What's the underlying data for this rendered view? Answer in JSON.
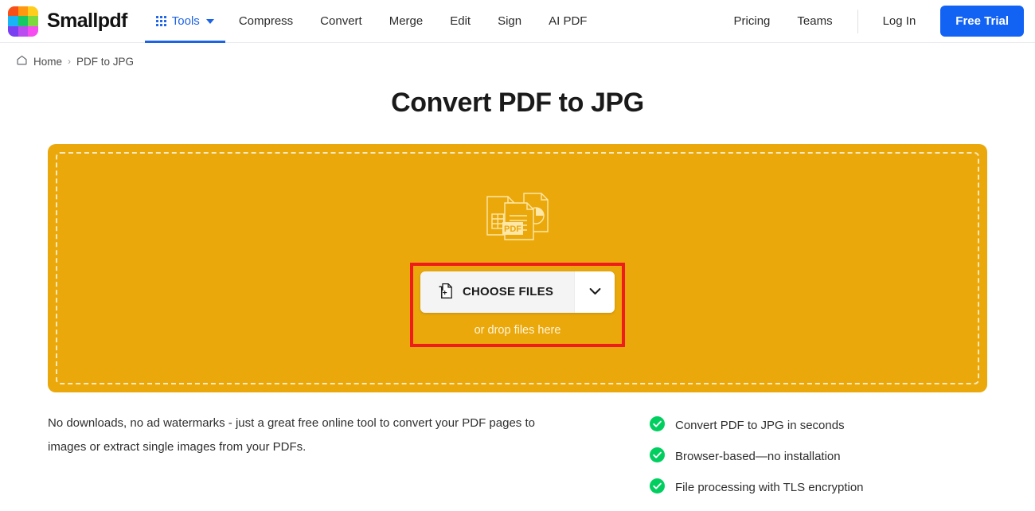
{
  "brand": {
    "name": "Smallpdf",
    "logo_colors": [
      "#f94f18",
      "#ff9811",
      "#ffcd1b",
      "#19b4f5",
      "#17c964",
      "#7ed93f",
      "#7b3ff2",
      "#bb4df0",
      "#f54df0"
    ]
  },
  "header": {
    "tools": {
      "label": "Tools",
      "icon": "grid-dots-icon",
      "caret": "chevron-down-icon",
      "active": true
    },
    "nav_items": [
      {
        "label": "Compress"
      },
      {
        "label": "Convert"
      },
      {
        "label": "Merge"
      },
      {
        "label": "Edit"
      },
      {
        "label": "Sign"
      },
      {
        "label": "AI PDF"
      }
    ],
    "right_items": [
      {
        "label": "Pricing"
      },
      {
        "label": "Teams"
      }
    ],
    "login_label": "Log In",
    "trial_label": "Free Trial",
    "accent_blue": "#1263f4"
  },
  "breadcrumb": {
    "home_icon": "home-icon",
    "home_label": "Home",
    "separator": "›",
    "current_label": "PDF to JPG"
  },
  "main": {
    "title": "Convert PDF to JPG"
  },
  "dropzone": {
    "background_color": "#eaa80b",
    "illustration": "pdf-documents-icon",
    "illustration_badge": "PDF",
    "choose_files_label": "CHOOSE FILES",
    "choose_files_icon": "file-add-icon",
    "caret_icon": "chevron-down-icon",
    "drop_hint": "or drop files here",
    "highlight_color": "#ef1c1c"
  },
  "bottom": {
    "blurb": "No downloads, no ad watermarks - just a great free online tool to convert your PDF pages to images or extract single images from your PDFs.",
    "check_color": "#00cf5f",
    "features": [
      {
        "label": "Convert PDF to JPG in seconds"
      },
      {
        "label": "Browser-based—no installation"
      },
      {
        "label": "File processing with TLS encryption"
      }
    ]
  }
}
